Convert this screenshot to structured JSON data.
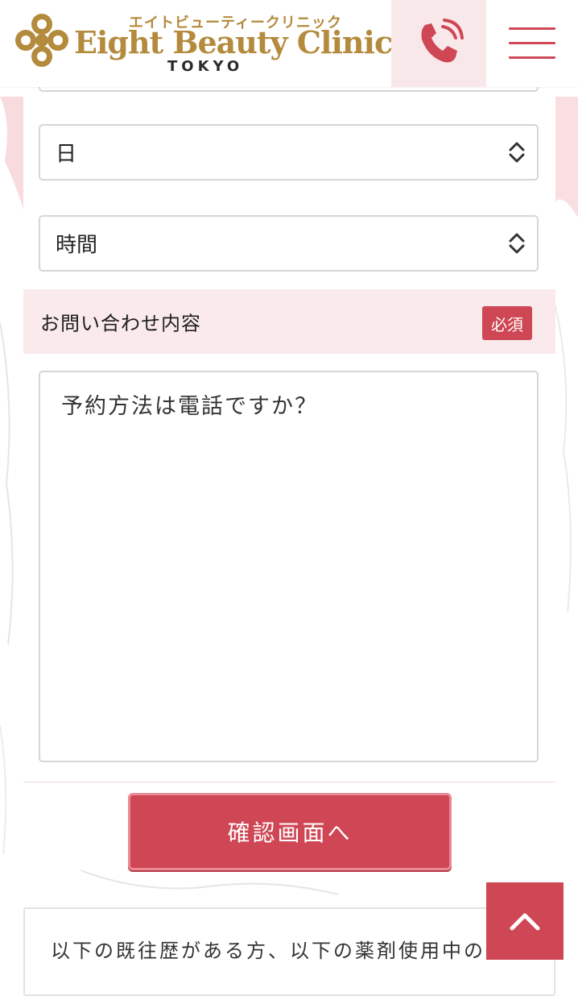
{
  "colors": {
    "accent": "#cf4654",
    "accent_light": "#faeaec",
    "gold": "#b48a3c"
  },
  "header": {
    "logo_kana": "エイトビューティークリニック",
    "logo_name": "Eight Beauty Clinic",
    "logo_sub": "TOKYO",
    "phone_icon": "phone-icon",
    "menu_icon": "hamburger-icon"
  },
  "form": {
    "day_select": {
      "value": "日"
    },
    "time_select": {
      "value": "時間"
    },
    "inquiry": {
      "label": "お問い合わせ内容",
      "required_badge": "必須",
      "value": "予約方法は電話ですか？"
    },
    "submit_label": "確認画面へ"
  },
  "notice": {
    "text": "以下の既往歴がある方、以下の薬剤使用中の方"
  },
  "pagetop": {
    "icon": "chevron-up-icon"
  }
}
